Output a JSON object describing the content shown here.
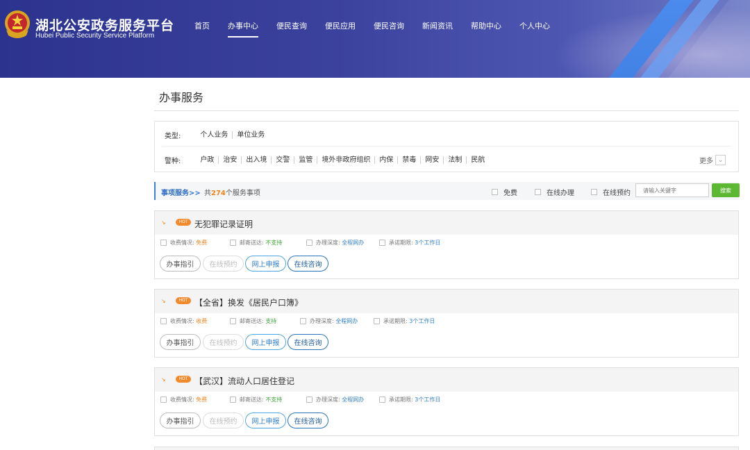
{
  "brand": {
    "title": "湖北公安政务服务平台",
    "subtitle": "Hubei Public Security Service Platform"
  },
  "nav": [
    {
      "label": "首页"
    },
    {
      "label": "办事中心",
      "active": true
    },
    {
      "label": "便民查询"
    },
    {
      "label": "便民应用"
    },
    {
      "label": "便民咨询"
    },
    {
      "label": "新闻资讯"
    },
    {
      "label": "帮助中心"
    },
    {
      "label": "个人中心"
    }
  ],
  "page": {
    "title": "办事服务"
  },
  "filters": {
    "type_label": "类型:",
    "types": [
      "个人业务",
      "单位业务"
    ],
    "police_label": "警种:",
    "police": [
      "户政",
      "治安",
      "出入境",
      "交警",
      "监管",
      "境外非政府组织",
      "内保",
      "禁毒",
      "网安",
      "法制",
      "民航"
    ],
    "more": "更多"
  },
  "list_bar": {
    "title": "事项服务>>",
    "count_prefix": "共",
    "count": "274",
    "count_suffix": "个服务事项",
    "checks": [
      "免费",
      "在线办理",
      "在线预约"
    ],
    "search_placeholder": "请输入关键字",
    "search_button": "搜索"
  },
  "labels": {
    "hot": "HOT",
    "fee": "收费情况:",
    "mail": "邮寄送达:",
    "depth": "办理深度:",
    "limit": "承诺期限:"
  },
  "buttons": {
    "guide": "办事指引",
    "appointment": "在线预约",
    "apply": "网上申报",
    "consult": "在线咨询"
  },
  "items": [
    {
      "title": "无犯罪记录证明",
      "fee": "免费",
      "mail": "不支持",
      "depth": "全程网办",
      "limit": "3个工作日"
    },
    {
      "title": "【全省】换发《居民户口簿》",
      "fee": "收费",
      "mail": "支持",
      "depth": "全程网办",
      "limit": "3个工作日"
    },
    {
      "title": "【武汉】流动人口居住登记",
      "fee": "免费",
      "mail": "不支持",
      "depth": "全程网办",
      "limit": "3个工作日"
    }
  ]
}
